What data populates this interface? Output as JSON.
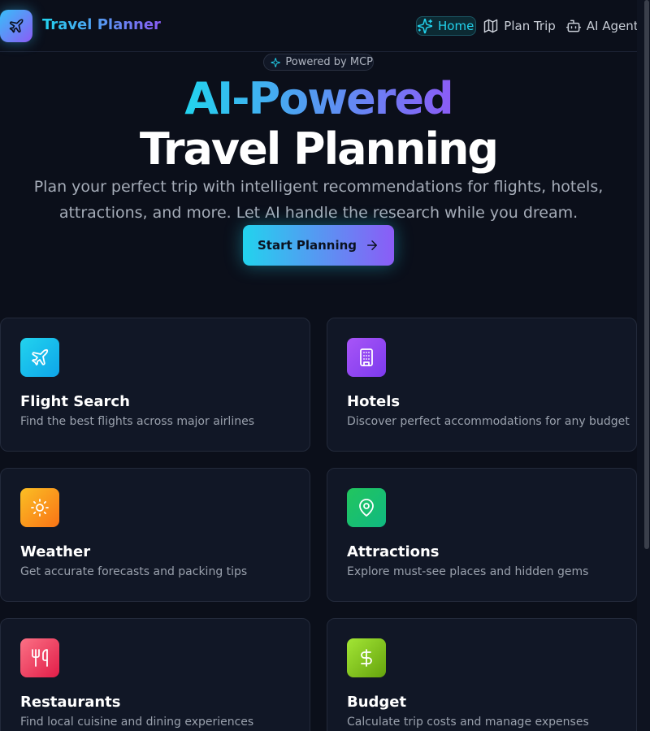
{
  "header": {
    "brand": "Travel Planner",
    "nav": [
      {
        "label": "Home",
        "icon": "sparkles-icon",
        "active": true
      },
      {
        "label": "Plan Trip",
        "icon": "map-icon",
        "active": false
      },
      {
        "label": "AI Agent",
        "icon": "bot-icon",
        "active": false
      }
    ]
  },
  "hero": {
    "badge": "Powered by MCP",
    "title_line1": "AI-Powered",
    "title_line2": "Travel Planning",
    "subtitle": "Plan your perfect trip with intelligent recommendations for flights, hotels, attractions, and more. Let AI handle the research while you dream.",
    "cta_label": "Start Planning"
  },
  "features": [
    {
      "title": "Flight Search",
      "description": "Find the best flights across major airlines",
      "icon": "plane-icon",
      "color_start": "#22d3ee",
      "color_end": "#0ea5e9"
    },
    {
      "title": "Hotels",
      "description": "Discover perfect accommodations for any budget",
      "icon": "building-icon",
      "color_start": "#a855f7",
      "color_end": "#7c3aed"
    },
    {
      "title": "Weather",
      "description": "Get accurate forecasts and packing tips",
      "icon": "sun-icon",
      "color_start": "#fbbf24",
      "color_end": "#f97316"
    },
    {
      "title": "Attractions",
      "description": "Explore must-see places and hidden gems",
      "icon": "map-pin-icon",
      "color_start": "#22c55e",
      "color_end": "#10b981"
    },
    {
      "title": "Restaurants",
      "description": "Find local cuisine and dining experiences",
      "icon": "utensils-icon",
      "color_start": "#fb7185",
      "color_end": "#e11d48"
    },
    {
      "title": "Budget",
      "description": "Calculate trip costs and manage expenses",
      "icon": "dollar-icon",
      "color_start": "#a3e635",
      "color_end": "#65a30d"
    }
  ],
  "colors": {
    "background": "#0b0f1a",
    "accent_start": "#22d3ee",
    "accent_end": "#8b5cf6"
  }
}
